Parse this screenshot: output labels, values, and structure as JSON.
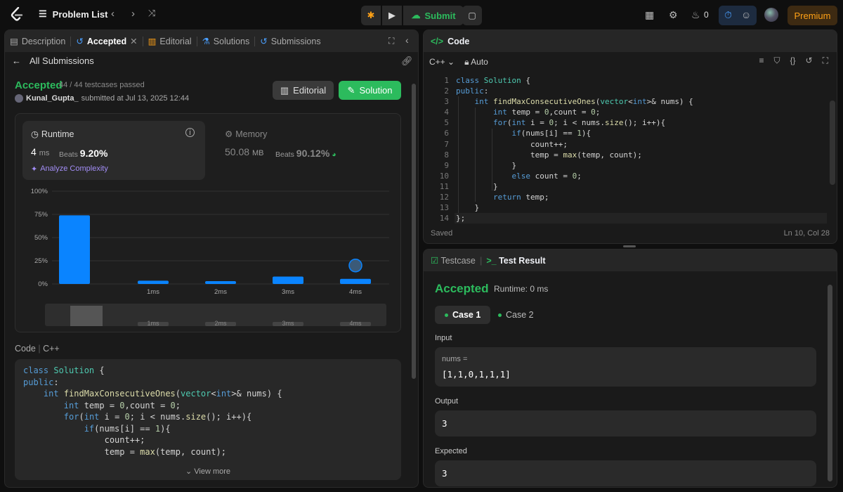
{
  "topbar": {
    "problem_list": "Problem List",
    "submit": "Submit",
    "streak": "0",
    "premium": "Premium"
  },
  "left_tabs": {
    "description": "Description",
    "accepted": "Accepted",
    "editorial": "Editorial",
    "solutions": "Solutions",
    "submissions": "Submissions"
  },
  "submission": {
    "back": "All Submissions",
    "status": "Accepted",
    "testcases": "44 / 44 testcases passed",
    "user": "Kunal_Gupta_",
    "submitted": "submitted at Jul 13, 2025 12:44",
    "editorial_btn": "Editorial",
    "solution_btn": "Solution"
  },
  "runtime": {
    "label": "Runtime",
    "value": "4",
    "unit": "ms",
    "beats_label": "Beats",
    "beats": "9.20%",
    "analyze": "Analyze Complexity"
  },
  "memory": {
    "label": "Memory",
    "value": "50.08",
    "unit": "MB",
    "beats_label": "Beats",
    "beats": "90.12%"
  },
  "chart_data": {
    "type": "bar",
    "yticks": [
      "100%",
      "75%",
      "50%",
      "25%",
      "0%"
    ],
    "ylim": [
      0,
      100
    ],
    "categories": [
      "",
      "1ms",
      "2ms",
      "3ms",
      "4ms"
    ],
    "values": [
      74,
      3.5,
      3,
      8,
      5.5
    ],
    "highlight": "4ms",
    "nav_labels": [
      "1ms",
      "2ms",
      "3ms",
      "4ms"
    ],
    "color": "#0a84ff"
  },
  "code_section": {
    "label": "Code",
    "lang": "C++",
    "view_more": "View more"
  },
  "code_preview": [
    "class Solution {",
    "public:",
    "    int findMaxConsecutiveOnes(vector<int>& nums) {",
    "        int temp = 0,count = 0;",
    "        for(int i = 0; i < nums.size(); i++){",
    "            if(nums[i] == 1){",
    "                count++;",
    "                temp = max(temp, count);"
  ],
  "editor": {
    "title": "Code",
    "lang": "C++",
    "mode": "Auto",
    "lines": [
      "class Solution {",
      "public:",
      "    int findMaxConsecutiveOnes(vector<int>& nums) {",
      "        int temp = 0,count = 0;",
      "        for(int i = 0; i < nums.size(); i++){",
      "            if(nums[i] == 1){",
      "                count++;",
      "                temp = max(temp, count);",
      "            }",
      "            else count = 0;",
      "        }",
      "        return temp;",
      "    }",
      "};"
    ],
    "status": "Saved",
    "cursor": "Ln 10, Col 28"
  },
  "test": {
    "tab_testcase": "Testcase",
    "tab_result": "Test Result",
    "status": "Accepted",
    "runtime": "Runtime: 0 ms",
    "case1": "Case 1",
    "case2": "Case 2",
    "input_label": "Input",
    "input_key": "nums =",
    "input_val": "[1,1,0,1,1,1]",
    "output_label": "Output",
    "output_val": "3",
    "expected_label": "Expected",
    "expected_val": "3"
  }
}
